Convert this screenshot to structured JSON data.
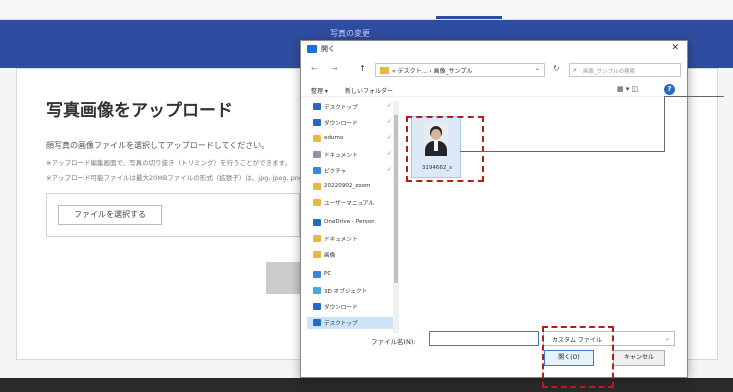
{
  "page": {
    "banner_title": "写真の変更",
    "heading": "写真画像をアップロード",
    "description": "顔写真の画像ファイルを選択してアップロードしてください。",
    "note1": "※アップロード編集画面で、写真の切り抜き（トリミング）を行うことができます。",
    "note2": "※アップロード可能ファイルは最大20MBファイルの形式（拡張子）は、jpg, jpeg, png",
    "choose_file_label": "ファイルを選択する"
  },
  "dialog": {
    "title": "開く",
    "close_glyph": "✕",
    "nav": {
      "back": "←",
      "forward": "→",
      "up": "↑"
    },
    "address": "« デスクト... › 画像_サンプル",
    "refresh": "↻",
    "search_placeholder": "画像_サンプルの検索",
    "toolbar": {
      "organize": "整理 ▾",
      "new_folder": "新しいフォルダー",
      "view_glyph": "▦ ▾  ◫"
    },
    "help_glyph": "?",
    "nav_items": [
      {
        "label": "デスクトップ",
        "icon": "desktop-icon",
        "color": "#2a68c8",
        "pin": true
      },
      {
        "label": "ダウンロード",
        "icon": "download-icon",
        "color": "#2a68c8",
        "pin": true
      },
      {
        "label": "edumo",
        "icon": "folder-icon",
        "color": "#e8b93a",
        "pin": true
      },
      {
        "label": "ドキュメント",
        "icon": "document-icon",
        "color": "#8c98a8",
        "pin": true
      },
      {
        "label": "ピクチャ",
        "icon": "picture-icon",
        "color": "#3d86d8",
        "pin": true
      },
      {
        "label": "20220902_zoom",
        "icon": "folder-icon",
        "color": "#e8b93a",
        "pin": false
      },
      {
        "label": "ユーザーマニュアル",
        "icon": "folder-icon",
        "color": "#e8b93a",
        "pin": false
      },
      {
        "label": "OneDrive - Person",
        "icon": "cloud-icon",
        "color": "#2a68c8",
        "pin": false
      },
      {
        "label": "ドキュメント",
        "icon": "folder-icon",
        "color": "#e8b93a",
        "pin": false
      },
      {
        "label": "画像",
        "icon": "folder-icon",
        "color": "#e8b93a",
        "pin": false
      },
      {
        "label": "PC",
        "icon": "pc-icon",
        "color": "#3d86d8",
        "pin": false
      },
      {
        "label": "3D オブジェクト",
        "icon": "3d-objects-icon",
        "color": "#49a6e0",
        "pin": false
      },
      {
        "label": "ダウンロード",
        "icon": "download-icon",
        "color": "#2a68c8",
        "pin": false
      },
      {
        "label": "デスクトップ",
        "icon": "desktop-icon",
        "color": "#2a68c8",
        "pin": false,
        "selected": true
      }
    ],
    "file": {
      "name": "3194662_s"
    },
    "filename_label": "ファイル名(N):",
    "filename_value": "",
    "filetype_label": "カスタム ファイル",
    "open_label": "開く(O)",
    "cancel_label": "キャンセル"
  },
  "colors": {
    "banner": "#2f4da0",
    "highlight": "#b51d1d",
    "selection": "#cce4f7"
  }
}
